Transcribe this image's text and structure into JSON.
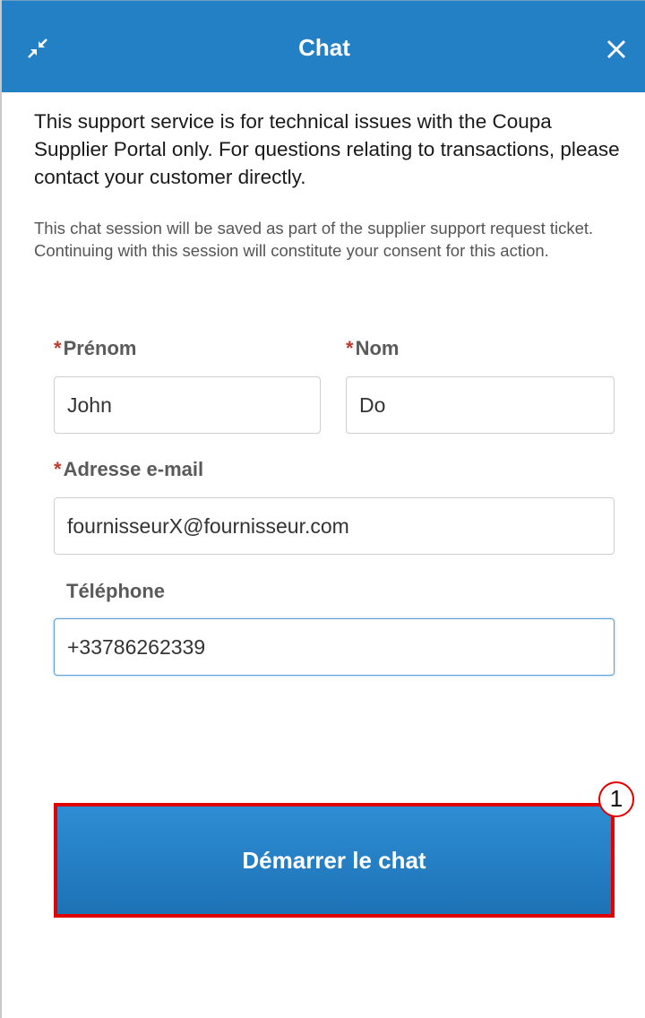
{
  "header": {
    "title": "Chat",
    "minimize_icon": "minimize-arrows-icon",
    "close_icon": "close-icon",
    "color": "#2480c5"
  },
  "intro_text": "This support service is for technical issues with the Coupa Supplier Portal only. For questions relating to transactions, please contact your customer directly.",
  "consent_text": "This chat session will be saved as part of the supplier support request ticket. Continuing with this session will constitute your consent for this action.",
  "form": {
    "required_marker": "*",
    "first_name": {
      "label": "Prénom",
      "value": "John",
      "required": true
    },
    "last_name": {
      "label": "Nom",
      "value": "Do",
      "required": true
    },
    "email": {
      "label": "Adresse e-mail",
      "value": "fournisseurX@fournisseur.com",
      "required": true
    },
    "phone": {
      "label": "Téléphone",
      "value": "+33786262339",
      "required": false
    }
  },
  "start_button": {
    "label": "Démarrer le chat"
  },
  "annotation": {
    "number": "1",
    "color": "#e00000"
  }
}
